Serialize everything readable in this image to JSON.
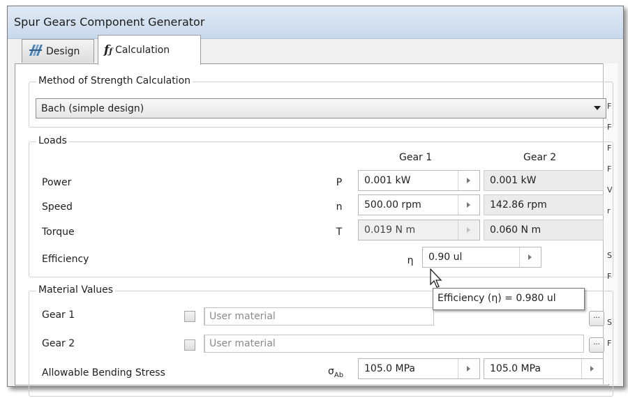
{
  "window": {
    "title": "Spur Gears Component Generator"
  },
  "tabs": [
    {
      "label": "Design",
      "icon": "gear-design-icon"
    },
    {
      "label": "Calculation",
      "icon": "function-icon"
    }
  ],
  "method": {
    "group_title": "Method of Strength Calculation",
    "selected": "Bach (simple design)"
  },
  "loads": {
    "group_title": "Loads",
    "col_gear1": "Gear 1",
    "col_gear2": "Gear 2",
    "rows": [
      {
        "label": "Power",
        "symbol": "P",
        "gear1": "0.001 kW",
        "gear2": "0.001 kW"
      },
      {
        "label": "Speed",
        "symbol": "n",
        "gear1": "500.00 rpm",
        "gear2": "142.86 rpm"
      },
      {
        "label": "Torque",
        "symbol": "T",
        "gear1": "0.019 N m",
        "gear2": "0.060 N m"
      }
    ],
    "efficiency": {
      "label": "Efficiency",
      "symbol": "η",
      "value": "0.90 ul"
    }
  },
  "material": {
    "group_title": "Material Values",
    "gear1_label": "Gear 1",
    "gear2_label": "Gear 2",
    "gear1_value": "User material",
    "gear2_value": "User material",
    "browse_label": "...",
    "bending_label": "Allowable Bending Stress",
    "bending_symbol": "σ",
    "bending_symbol_sub": "Ab",
    "bending_gear1": "105.0 MPa",
    "bending_gear2": "105.0 MPa"
  },
  "tooltip": {
    "text": "Efficiency (η) = 0.980 ul"
  },
  "side_letters": [
    "F",
    "F",
    "F",
    "F",
    "V",
    "r",
    "S",
    "F",
    "S",
    "F"
  ]
}
